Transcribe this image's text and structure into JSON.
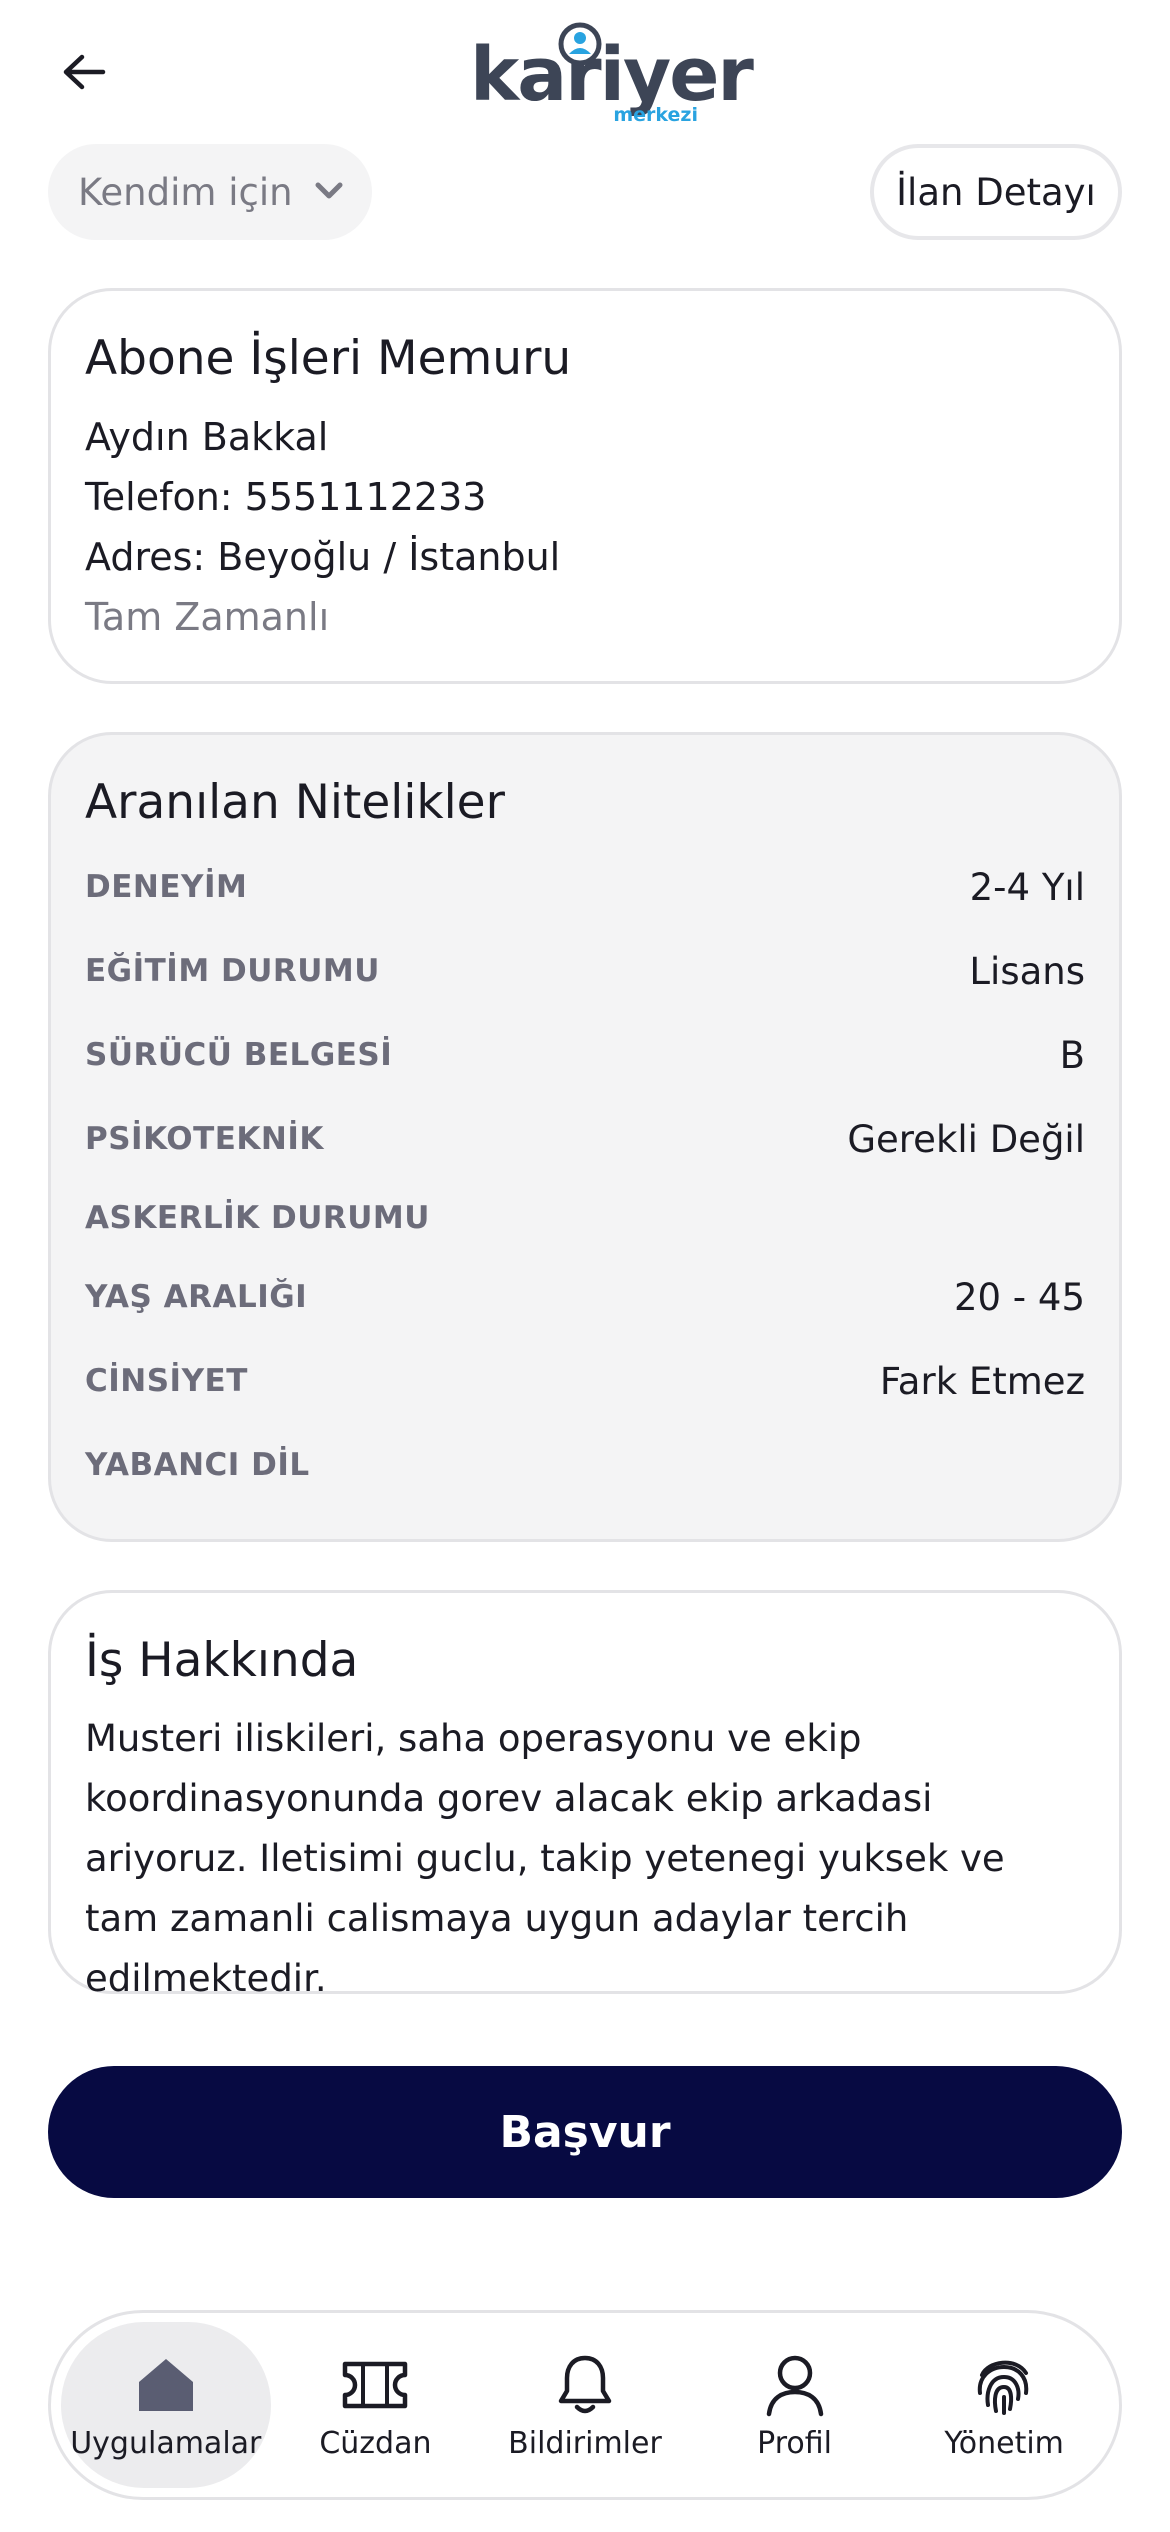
{
  "header": {
    "back_icon": "arrow-left-icon",
    "logo_main": "kariyer",
    "logo_sub": "merkezi",
    "logo_colors": {
      "main": "#3d4556",
      "accent": "#29a3e0"
    }
  },
  "filters": {
    "audience_selected": "Kendim için",
    "detail_button": "İlan Detayı"
  },
  "job": {
    "title": "Abone İşleri Memuru",
    "company": "Aydın Bakkal",
    "phone": "Telefon: 5551112233",
    "address": "Adres: Beyoğlu / İstanbul",
    "employment_type": "Tam Zamanlı"
  },
  "requirements": {
    "title": "Aranılan Nitelikler",
    "rows": [
      {
        "label": "DENEYİM",
        "value": "2-4 Yıl"
      },
      {
        "label": "EĞİTİM DURUMU",
        "value": "Lisans"
      },
      {
        "label": "SÜRÜCÜ BELGESİ",
        "value": "B"
      },
      {
        "label": "PSİKOTEKNİK",
        "value": "Gerekli Değil"
      },
      {
        "label": "ASKERLİK DURUMU",
        "value": ""
      },
      {
        "label": "YAŞ ARALIĞI",
        "value": "20 - 45"
      },
      {
        "label": "CİNSİYET",
        "value": "Fark Etmez"
      },
      {
        "label": "YABANCI DİL",
        "value": ""
      }
    ]
  },
  "about": {
    "title": "İş Hakkında",
    "text": "Musteri iliskileri, saha operasyonu ve ekip koordinasyonunda gorev alacak ekip arkadasi ariyoruz. Iletisimi guclu, takip yetenegi yuksek ve tam zamanli calismaya uygun adaylar tercih edilmektedir."
  },
  "apply": {
    "label": "Başvur",
    "color": "#070a42"
  },
  "nav": {
    "items": [
      {
        "label": "Uygulamalar",
        "icon": "home-icon",
        "active": true
      },
      {
        "label": "Cüzdan",
        "icon": "ticket-icon",
        "active": false
      },
      {
        "label": "Bildirimler",
        "icon": "bell-icon",
        "active": false
      },
      {
        "label": "Profil",
        "icon": "user-icon",
        "active": false
      },
      {
        "label": "Yönetim",
        "icon": "fingerprint-icon",
        "active": false
      }
    ]
  }
}
